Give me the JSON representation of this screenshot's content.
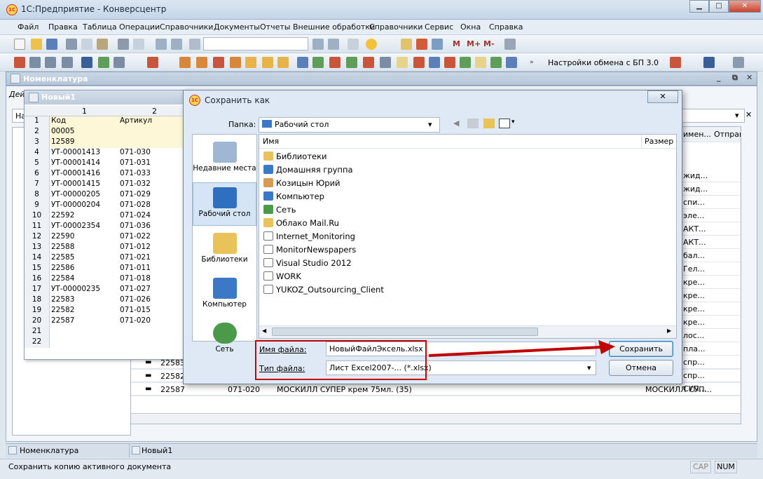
{
  "app": {
    "title": "1С:Предприятие - Конверсцентр"
  },
  "menu": {
    "items": [
      "Файл",
      "Правка",
      "Таблица",
      "Операции",
      "Справочники",
      "Документы",
      "Отчеты",
      "Внешние обработки",
      "Справочники",
      "Сервис",
      "Окна",
      "Справка"
    ]
  },
  "toolbar2": {
    "exchange_settings": "Настройки обмена с БП 3.0"
  },
  "toolbar_m": [
    "M",
    "M+",
    "M-"
  ],
  "nomenclature": {
    "title": "Номенклатура",
    "actions_label": "Дей",
    "filter_label": "На",
    "right_headers": [
      "имен...",
      "Отправ"
    ],
    "right_tail": [
      "жид...",
      "жид...",
      "спи...",
      "эле...",
      "АКТ...",
      "АКТ...",
      "бал...",
      "Гел...",
      "кре...",
      "кре...",
      "кре...",
      "кре...",
      "лос...",
      "пла...",
      "спр...",
      "спр...",
      "СУП..."
    ],
    "bottom_rows": [
      {
        "code": "22583",
        "art": "",
        "name": "",
        "full": ""
      },
      {
        "code": "22582",
        "art": "",
        "name": "",
        "full": ""
      },
      {
        "code": "22587",
        "art": "071-020",
        "name": "МОСКИЛЛ СУПЕР крем 75мл. (35)",
        "full": "МОСКИЛЛ СУП..."
      }
    ]
  },
  "sheet": {
    "title": "Новый1",
    "col_headers": [
      "1",
      "2"
    ],
    "rows": [
      {
        "n": "1",
        "c1": "Код",
        "c2": "Артикул"
      },
      {
        "n": "2",
        "c1": "00005",
        "c2": ""
      },
      {
        "n": "3",
        "c1": "12589",
        "c2": ""
      },
      {
        "n": "4",
        "c1": "УТ-00001413",
        "c2": "071-030"
      },
      {
        "n": "5",
        "c1": "УТ-00001414",
        "c2": "071-031"
      },
      {
        "n": "6",
        "c1": "УТ-00001416",
        "c2": "071-033"
      },
      {
        "n": "7",
        "c1": "УТ-00001415",
        "c2": "071-032"
      },
      {
        "n": "8",
        "c1": "УТ-00000205",
        "c2": "071-029"
      },
      {
        "n": "9",
        "c1": "УТ-00000204",
        "c2": "071-028"
      },
      {
        "n": "10",
        "c1": "22592",
        "c2": "071-024"
      },
      {
        "n": "11",
        "c1": "УТ-00002354",
        "c2": "071-036"
      },
      {
        "n": "12",
        "c1": "22590",
        "c2": "071-022"
      },
      {
        "n": "13",
        "c1": "22588",
        "c2": "071-012"
      },
      {
        "n": "14",
        "c1": "22585",
        "c2": "071-021"
      },
      {
        "n": "15",
        "c1": "22586",
        "c2": "071-011"
      },
      {
        "n": "16",
        "c1": "22584",
        "c2": "071-018"
      },
      {
        "n": "17",
        "c1": "УТ-00000235",
        "c2": "071-027"
      },
      {
        "n": "18",
        "c1": "22583",
        "c2": "071-026"
      },
      {
        "n": "19",
        "c1": "22582",
        "c2": "071-015"
      },
      {
        "n": "20",
        "c1": "22587",
        "c2": "071-020"
      },
      {
        "n": "21",
        "c1": "",
        "c2": ""
      },
      {
        "n": "22",
        "c1": "",
        "c2": ""
      }
    ]
  },
  "dialog": {
    "title": "Сохранить как",
    "folder_label": "Папка:",
    "folder_value": "Рабочий стол",
    "places": [
      "Недавние места",
      "Рабочий стол",
      "Библиотеки",
      "Компьютер",
      "Сеть"
    ],
    "col_name": "Имя",
    "col_size": "Размер",
    "files": [
      "Библиотеки",
      "Домашняя группа",
      "Козицын Юрий",
      "Компьютер",
      "Сеть",
      "Облако Mail.Ru",
      "Internet_Monitoring",
      "MonitorNewspapers",
      "Visual Studio 2012",
      "WORK",
      "YUKOZ_Outsourcing_Client"
    ],
    "filename_label": "Имя файла:",
    "filename_value": "НовыйФайлЭксель.xlsx",
    "filetype_label": "Тип файла:",
    "filetype_value": "Лист Excel2007-... (*.xlsx)",
    "save_button": "Сохранить",
    "cancel_button": "Отмена"
  },
  "tabs": [
    "Номенклатура",
    "Новый1"
  ],
  "status": {
    "text": "Сохранить копию активного документа",
    "cap": "CAP",
    "num": "NUM"
  },
  "colors": {
    "highlight_box": "#c00000",
    "arrow": "#c00000"
  }
}
